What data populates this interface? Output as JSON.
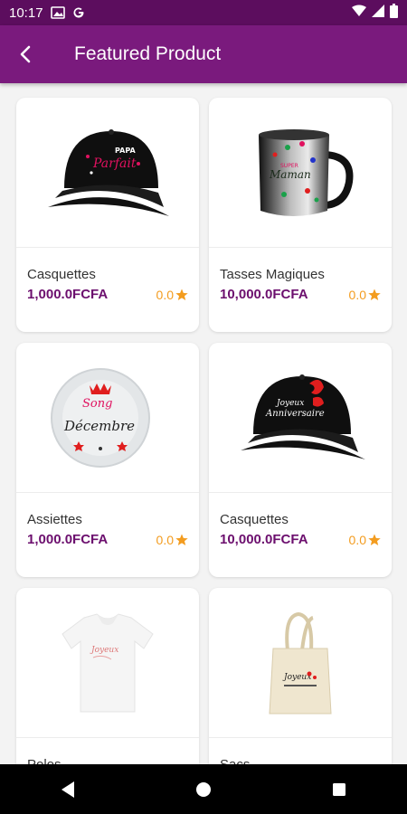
{
  "status_bar": {
    "time": "10:17",
    "icons": [
      "image-icon",
      "google-icon",
      "wifi-icon",
      "signal-icon",
      "battery-icon"
    ]
  },
  "app_bar": {
    "title": "Featured Product",
    "back_icon": "back-arrow-icon"
  },
  "colors": {
    "status_bar": "#5c0d5e",
    "app_bar": "#7a1a7d",
    "price": "#6c0f6e",
    "rating": "#f39c1f",
    "background": "#f3f3f3"
  },
  "products": [
    {
      "name": "Casquettes",
      "price": "1,000.0FCFA",
      "rating": "0.0",
      "image": "black-cap-red-text",
      "image_text": "Papa Parfait"
    },
    {
      "name": "Tasses Magiques",
      "price": "10,000.0FCFA",
      "rating": "0.0",
      "image": "magic-mug",
      "image_text": "Super Maman"
    },
    {
      "name": "Assiettes",
      "price": "1,000.0FCFA",
      "rating": "0.0",
      "image": "decorated-plate",
      "image_text": "Décembre"
    },
    {
      "name": "Casquettes",
      "price": "10,000.0FCFA",
      "rating": "0.0",
      "image": "black-cap-white-text",
      "image_text": "Joyeux Anniversaire"
    },
    {
      "name": "Polos",
      "price": "",
      "rating": "",
      "image": "white-polo",
      "image_text": ""
    },
    {
      "name": "Sacs",
      "price": "",
      "rating": "",
      "image": "tote-bag",
      "image_text": ""
    }
  ],
  "nav_bar": {
    "buttons": [
      "back-triangle-icon",
      "home-circle-icon",
      "recents-square-icon"
    ]
  }
}
